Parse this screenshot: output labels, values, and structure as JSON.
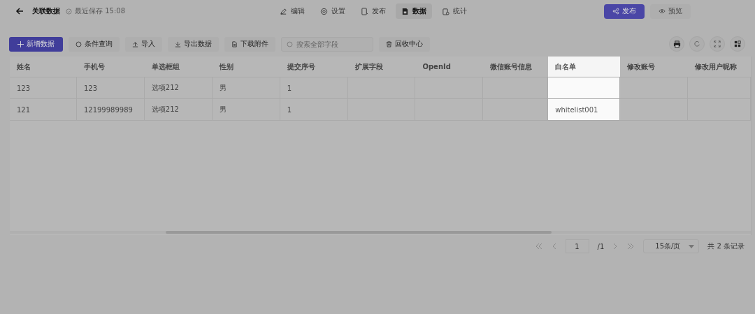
{
  "header": {
    "title": "关联数据",
    "save_status": "最近保存 15:08"
  },
  "nav_tabs": [
    {
      "label": "编辑",
      "selected": false
    },
    {
      "label": "设置",
      "selected": false
    },
    {
      "label": "发布",
      "selected": false
    },
    {
      "label": "数据",
      "selected": true
    },
    {
      "label": "统计",
      "selected": false
    }
  ],
  "publish_button": "发布",
  "preview_button": "预览",
  "toolbar": {
    "add_button": "新增数据",
    "buttons": [
      "条件查询",
      "导入",
      "导出数据",
      "下载附件"
    ],
    "search": {
      "placeholder": "搜索全部字段"
    },
    "recycle_button": "回收中心"
  },
  "table": {
    "columns": [
      {
        "label": "姓名",
        "highlighted": false
      },
      {
        "label": "手机号",
        "highlighted": false
      },
      {
        "label": "单选框组",
        "highlighted": false
      },
      {
        "label": "性别",
        "highlighted": false
      },
      {
        "label": "提交序号",
        "highlighted": false
      },
      {
        "label": "扩展字段",
        "highlighted": false
      },
      {
        "label": "OpenId",
        "highlighted": false
      },
      {
        "label": "微信账号信息",
        "highlighted": false
      },
      {
        "label": "白名单",
        "highlighted": true
      },
      {
        "label": "修改账号",
        "highlighted": false
      },
      {
        "label": "修改用户昵称",
        "highlighted": false
      }
    ],
    "rows": [
      [
        "123",
        "123",
        "选项212",
        "男",
        "1",
        "",
        "",
        "",
        "",
        "",
        ""
      ],
      [
        "121",
        "12199989989",
        "选项212",
        "男",
        "1",
        "",
        "",
        "",
        "whitelist001",
        "",
        ""
      ]
    ]
  },
  "pagination": {
    "page": "1",
    "total_pages": "/1",
    "page_size": "15条/页",
    "summary": "共 2 条记录"
  }
}
